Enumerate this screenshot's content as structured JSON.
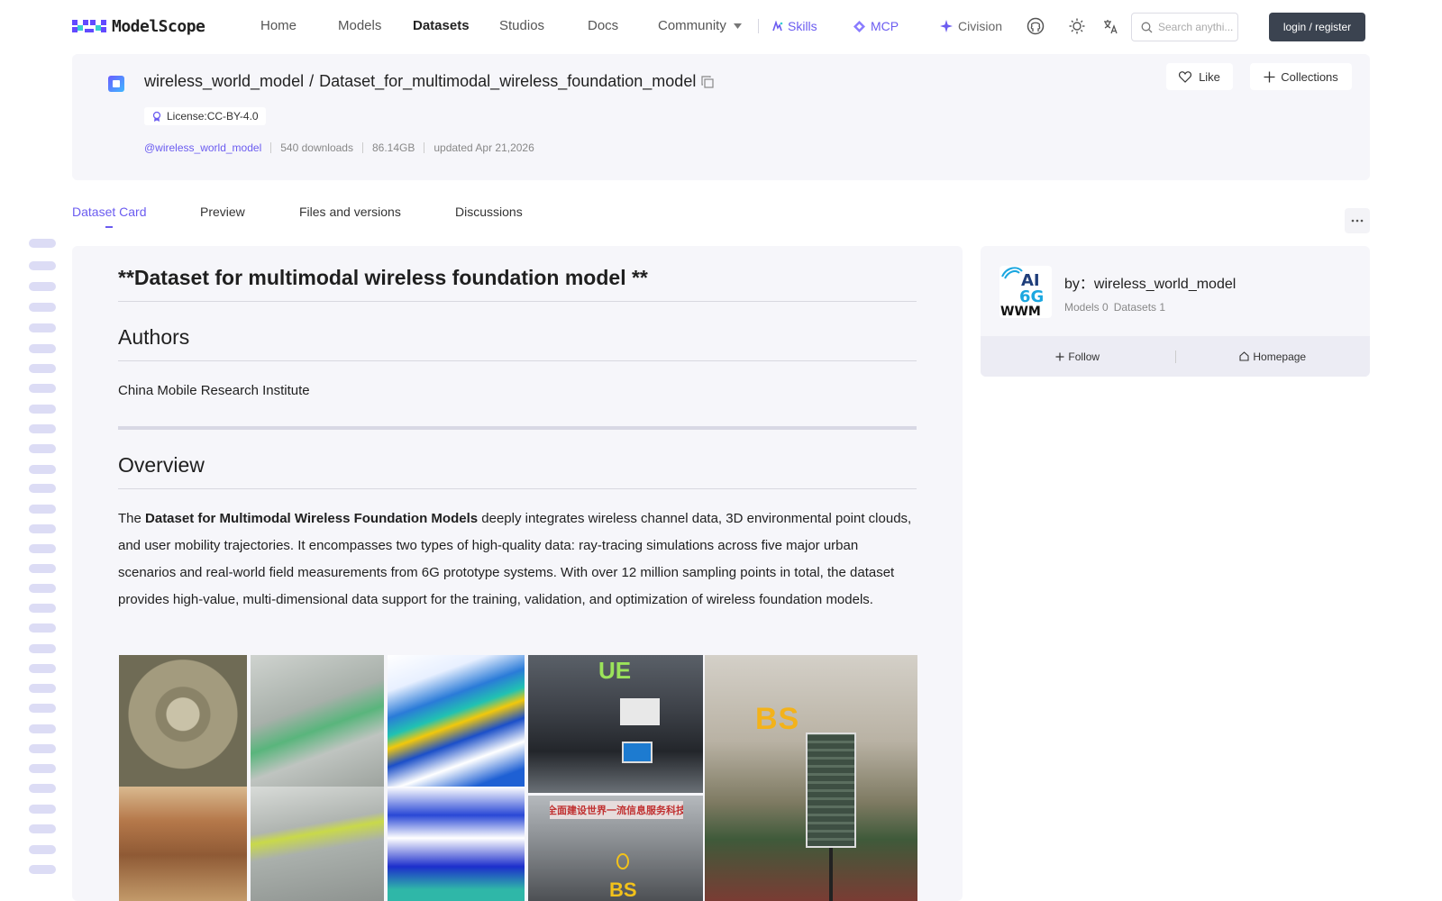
{
  "nav": {
    "logo_text": "ModelScope",
    "items": [
      {
        "label": "Home"
      },
      {
        "label": "Models"
      },
      {
        "label": "Datasets",
        "active": true
      },
      {
        "label": "Studios"
      },
      {
        "label": "Docs"
      },
      {
        "label": "Community"
      }
    ],
    "skills": "Skills",
    "mcp": "MCP",
    "civision": "Civision",
    "search_placeholder": "Search anythi...",
    "login": "login / register"
  },
  "dataset": {
    "owner": "wireless_world_model",
    "slash": "/",
    "name": "Dataset_for_multimodal_wireless_foundation_model",
    "license": "License:CC-BY-4.0",
    "owner_handle": "@wireless_world_model",
    "downloads": "540 downloads",
    "size": "86.14GB",
    "updated": "updated Apr 21,2026",
    "like": "Like",
    "collections": "Collections"
  },
  "tabs": [
    {
      "label": "Dataset Card",
      "active": true
    },
    {
      "label": "Preview"
    },
    {
      "label": "Files and versions"
    },
    {
      "label": "Discussions"
    }
  ],
  "card": {
    "title": "**Dataset for multimodal wireless foundation model **",
    "authors_heading": "Authors",
    "authors": "China Mobile Research Institute",
    "overview_heading": "Overview",
    "overview_pre": "The ",
    "overview_bold": "Dataset for Multimodal Wireless Foundation Models",
    "overview_post": " deeply integrates wireless channel data, 3D environmental point clouds, and user mobility trajectories. It encompasses two types of high-quality data: ray-tracing simulations across five major urban scenarios and real-world field measurements from 6G prototype systems. With over 12 million sampling points in total, the dataset provides high-value, multi-dimensional data support for the training, validation, and optimization of wireless foundation models.",
    "image_labels": {
      "ue": "UE",
      "bs": "BS",
      "bs2": "BS",
      "banner": "全面建设世界一流信息服务科技"
    }
  },
  "author": {
    "by": "by：wireless_world_model",
    "models": "Models 0",
    "datasets": "Datasets 1",
    "follow": "Follow",
    "homepage": "Homepage",
    "logo_line1": "AI",
    "logo_line2": "6G",
    "logo_line3": "WWM"
  },
  "colors": {
    "accent": "#6b5cf0",
    "login_bg": "#3b4350",
    "card_bg": "#f6f6fa"
  }
}
